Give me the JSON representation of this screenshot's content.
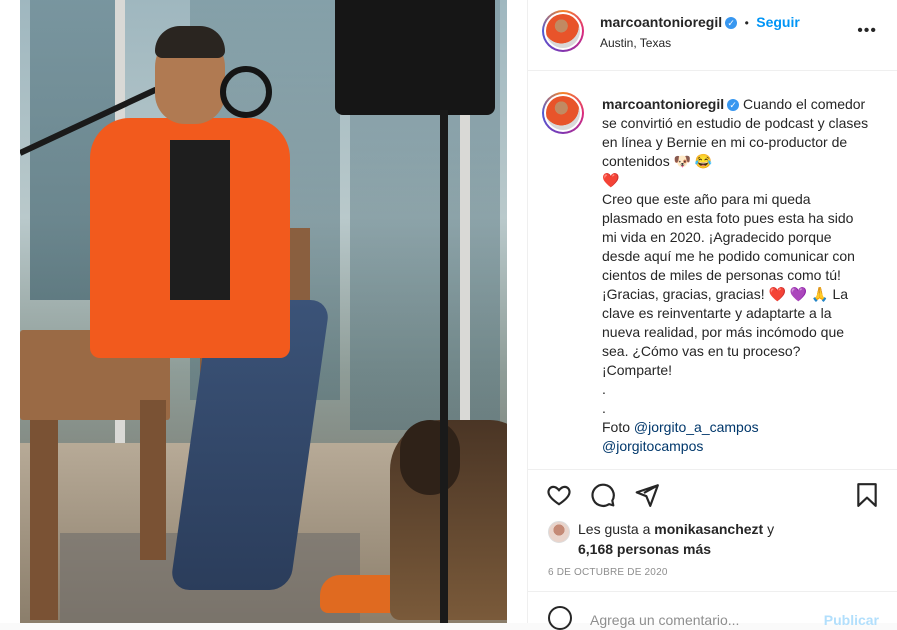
{
  "post": {
    "username": "marcoantonioregil",
    "verified": true,
    "follow_label": "Seguir",
    "separator": "•",
    "location": "Austin, Texas",
    "more_icon": "more-horizontal-icon",
    "caption": {
      "line1": "Cuando el comedor se convirtió en estudio de podcast y clases en línea y Bernie en mi co-productor de contenidos",
      "emoji1": "🐶 😂",
      "emoji2": "❤️",
      "line2": "Creo que este año para mi queda plasmado en esta foto pues esta ha sido mi vida en 2020. ¡Agradecido porque desde aquí me he podido comunicar con cientos de miles de personas como tú! ¡Gracias, gracias, gracias!",
      "emoji3": "❤️ 💜 🙏",
      "line3": "La clave es reinventarte y adaptarte a la nueva realidad, por más incómodo que sea. ¿Cómo vas en tu proceso? ¡Comparte!",
      "dot1": ".",
      "dot2": ".",
      "credit_prefix": "Foto",
      "mention1": "@jorgito_a_campos",
      "mention2": "@jorgitocampos"
    },
    "likes": {
      "prefix": "Les gusta a",
      "liker": "monikasanchezt",
      "conj": "y",
      "count_text": "6,168 personas más"
    },
    "date": "6 de octubre de 2020",
    "comment": {
      "placeholder": "Agrega un comentario...",
      "publish_label": "Publicar"
    }
  },
  "icons": [
    "heart-icon",
    "comment-icon",
    "share-icon",
    "bookmark-icon",
    "emoji-icon"
  ],
  "colors": {
    "link_blue": "#0095f6",
    "mention": "#00376b",
    "muted": "#8e8e8e",
    "border": "#efefef"
  }
}
